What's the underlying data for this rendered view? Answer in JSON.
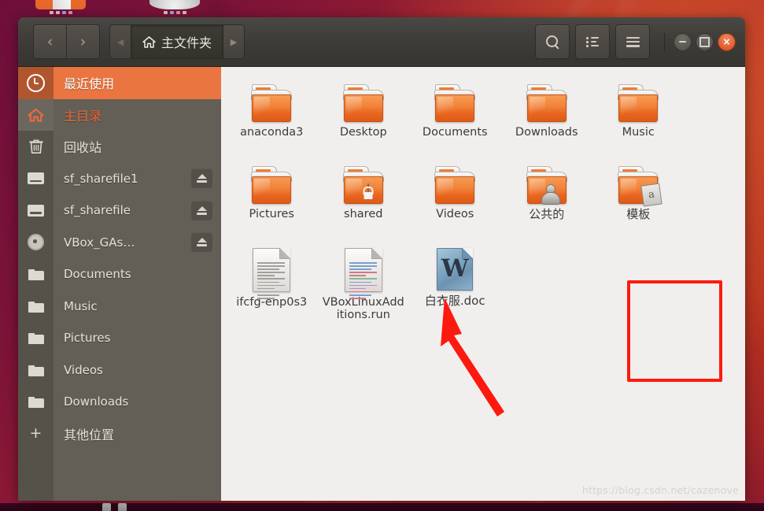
{
  "desktop": {
    "watermark": "https://blog.csdn.net/cazenove"
  },
  "window": {
    "titlebar": {
      "back_label": "‹",
      "forward_label": "›",
      "path_prev_label": "◀",
      "path_next_label": "▶",
      "breadcrumb": "主文件夹",
      "search_label": "",
      "list_view_label": "",
      "menu_label": "",
      "minimize_label": "",
      "maximize_label": "",
      "close_label": "×"
    },
    "sidebar": {
      "items": [
        {
          "label": "最近使用",
          "icon": "clock-icon",
          "state": "active",
          "eject": false,
          "cjk": true
        },
        {
          "label": "主目录",
          "icon": "home-icon",
          "state": "home",
          "eject": false,
          "cjk": true
        },
        {
          "label": "回收站",
          "icon": "trash-icon",
          "state": "",
          "eject": false,
          "cjk": true
        },
        {
          "label": "sf_sharefile1",
          "icon": "drive-icon",
          "state": "",
          "eject": true,
          "cjk": false
        },
        {
          "label": "sf_sharefile",
          "icon": "drive-icon",
          "state": "",
          "eject": true,
          "cjk": false
        },
        {
          "label": "VBox_GAs…",
          "icon": "disc-icon",
          "state": "",
          "eject": true,
          "cjk": false
        },
        {
          "label": "Documents",
          "icon": "folder-icon",
          "state": "",
          "eject": false,
          "cjk": false
        },
        {
          "label": "Music",
          "icon": "folder-icon",
          "state": "",
          "eject": false,
          "cjk": false
        },
        {
          "label": "Pictures",
          "icon": "folder-icon",
          "state": "",
          "eject": false,
          "cjk": false
        },
        {
          "label": "Videos",
          "icon": "folder-icon",
          "state": "",
          "eject": false,
          "cjk": false
        },
        {
          "label": "Downloads",
          "icon": "folder-icon",
          "state": "",
          "eject": false,
          "cjk": false
        },
        {
          "label": "其他位置",
          "icon": "plus-icon",
          "state": "",
          "eject": false,
          "cjk": true
        }
      ]
    },
    "files": [
      {
        "name": "anaconda3",
        "type": "folder",
        "badge": "",
        "cjk": false,
        "highlighted": false
      },
      {
        "name": "Desktop",
        "type": "folder",
        "badge": "",
        "cjk": false,
        "highlighted": false
      },
      {
        "name": "Documents",
        "type": "folder",
        "badge": "",
        "cjk": false,
        "highlighted": false
      },
      {
        "name": "Downloads",
        "type": "folder",
        "badge": "",
        "cjk": false,
        "highlighted": false
      },
      {
        "name": "Music",
        "type": "folder",
        "badge": "",
        "cjk": false,
        "highlighted": false
      },
      {
        "name": "Pictures",
        "type": "folder",
        "badge": "",
        "cjk": false,
        "highlighted": false
      },
      {
        "name": "shared",
        "type": "folder",
        "badge": "lock",
        "cjk": false,
        "highlighted": false
      },
      {
        "name": "Videos",
        "type": "folder",
        "badge": "",
        "cjk": false,
        "highlighted": false
      },
      {
        "name": "公共的",
        "type": "folder",
        "badge": "person",
        "cjk": true,
        "highlighted": false
      },
      {
        "name": "模板",
        "type": "folder",
        "badge": "template",
        "cjk": true,
        "highlighted": false
      },
      {
        "name": "ifcfg-enp0s3",
        "type": "document",
        "badge": "",
        "cjk": false,
        "highlighted": false
      },
      {
        "name": "VBoxLinuxAdditions.run",
        "type": "script",
        "badge": "",
        "cjk": false,
        "highlighted": false
      },
      {
        "name": "白衣服.doc",
        "type": "word",
        "badge": "",
        "cjk": true,
        "highlighted": true
      }
    ],
    "annotation": {
      "highlight_color": "#fc1a10",
      "arrow_color": "#fc1a10",
      "target_file": "白衣服.doc"
    }
  }
}
